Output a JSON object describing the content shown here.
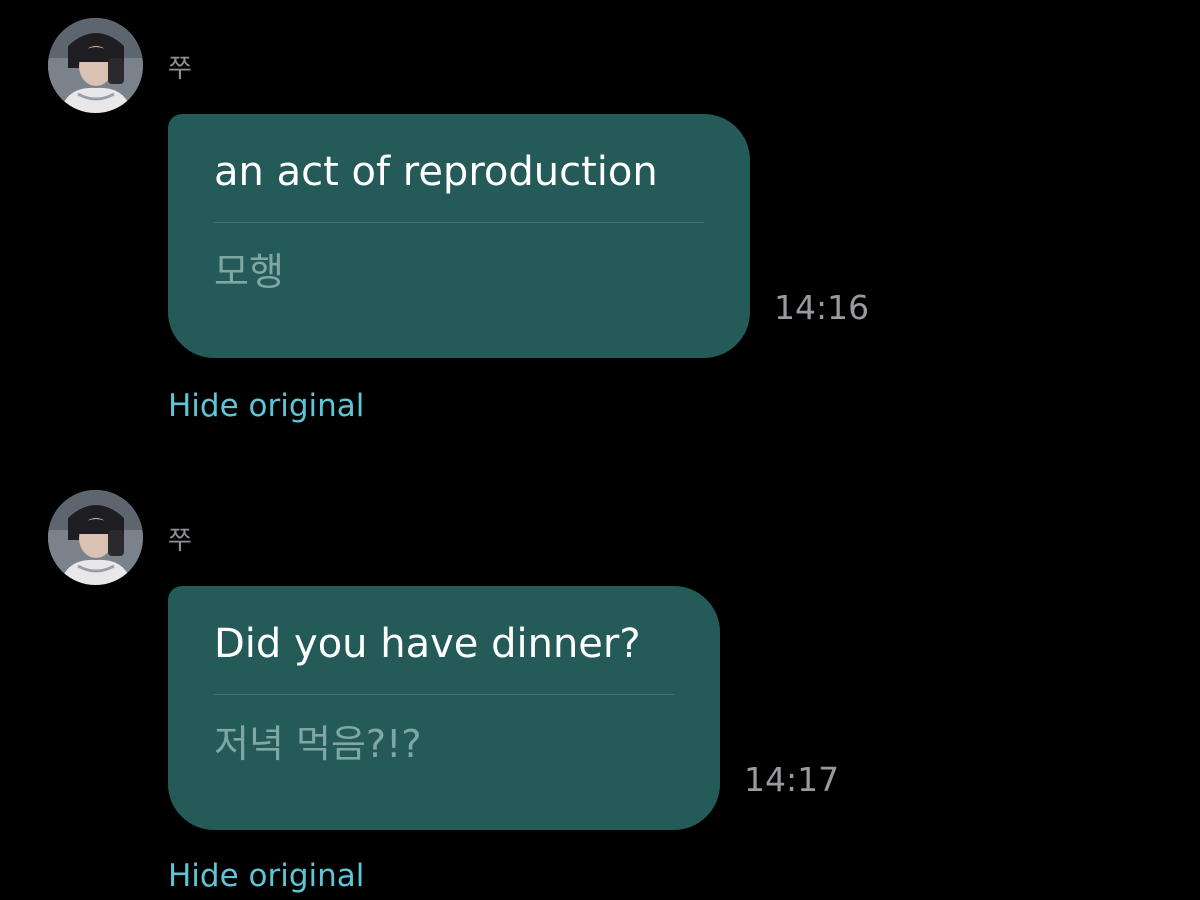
{
  "messages": [
    {
      "sender": "쭈",
      "avatar_icon": "profile-photo",
      "translated_text": "an act of reproduction",
      "original_text": "모행",
      "time": "14:16",
      "toggle_label": "Hide original"
    },
    {
      "sender": "쭈",
      "avatar_icon": "profile-photo",
      "translated_text": "Did you have dinner?",
      "original_text": "저녁 먹음?!?",
      "time": "14:17",
      "toggle_label": "Hide original"
    }
  ],
  "colors": {
    "background": "#000000",
    "bubble": "#245a58",
    "link": "#5fc4d6",
    "muted": "#9a9a9e"
  }
}
